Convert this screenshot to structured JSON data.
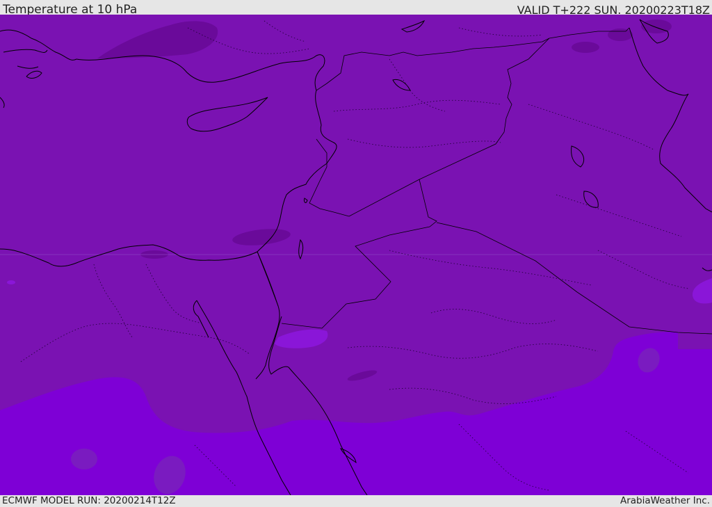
{
  "header": {
    "title": "Temperature at 10 hPa",
    "valid_time": "VALID T+222 SUN. 20200223T18Z"
  },
  "footer": {
    "model_run": "ECMWF MODEL RUN: 20200214T12Z",
    "credit": "ArabiaWeather Inc."
  },
  "colors": {
    "field_main": "#7a12b2",
    "field_warm_band": "#7e00d6",
    "field_cool_patch": "#6a0a9a",
    "field_light_patch": "#8a16d8",
    "coastline": "#000000",
    "background": "#e6e6e6"
  }
}
